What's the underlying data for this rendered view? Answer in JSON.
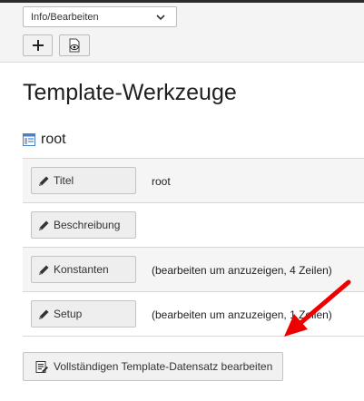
{
  "header": {
    "module_select_value": "Info/Bearbeiten",
    "colors": {
      "topbar": "#f4f4f4",
      "topstrip": "#2b2b2b"
    }
  },
  "toolbar": {
    "add_icon": "plus-icon",
    "view_icon": "view-page-icon"
  },
  "page": {
    "title": "Template-Werkzeuge",
    "root_label": "root",
    "root_icon": "template-icon"
  },
  "rows": [
    {
      "button_label": "Titel",
      "value": "root"
    },
    {
      "button_label": "Beschreibung",
      "value": ""
    },
    {
      "button_label": "Konstanten",
      "value": "(bearbeiten um anzuzeigen, 4 Zeilen)"
    },
    {
      "button_label": "Setup",
      "value": "(bearbeiten um anzuzeigen, 1 Zeilen)"
    }
  ],
  "full_edit_button": {
    "label": "Vollständigen Template-Datensatz bearbeiten",
    "icon": "edit-record-icon"
  },
  "annotation": {
    "arrow_color": "#ee0000"
  }
}
